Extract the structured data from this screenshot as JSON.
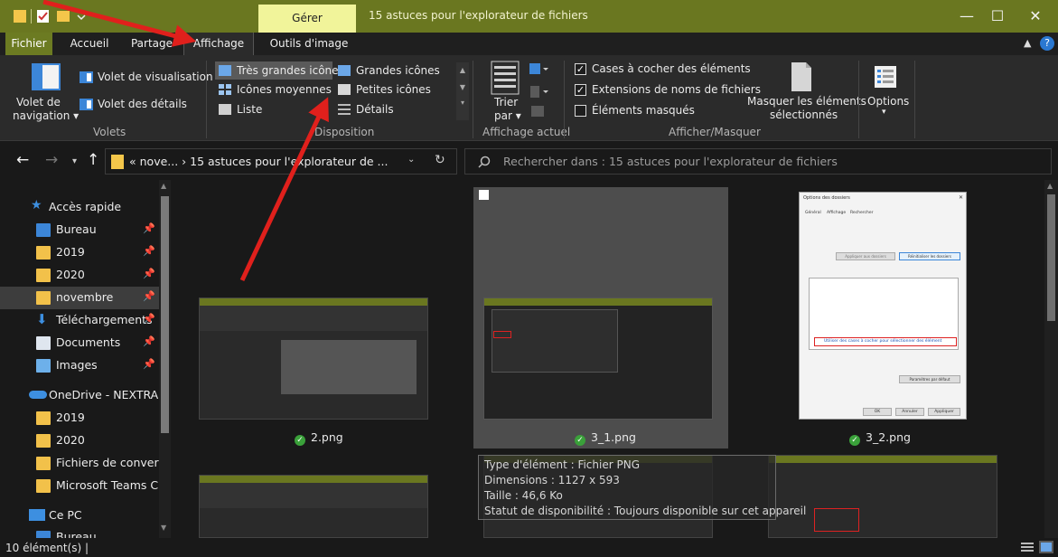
{
  "window": {
    "manage_label": "Gérer",
    "title": "15 astuces pour l'explorateur de fichiers",
    "minimize": "—",
    "maximize": "☐",
    "close": "✕"
  },
  "tabs": [
    "Fichier",
    "Accueil",
    "Partage",
    "Affichage",
    "Outils d'image"
  ],
  "ribbon": {
    "panes": {
      "nav_pane_line1": "Volet de",
      "nav_pane_line2": "navigation ▾",
      "preview_pane": "Volet de visualisation",
      "details_pane": "Volet des détails",
      "group": "Volets"
    },
    "layout": {
      "xl_icons": "Très grandes icônes",
      "large_icons": "Grandes icônes",
      "medium_icons": "Icônes moyennes",
      "small_icons": "Petites icônes",
      "list": "Liste",
      "details": "Détails",
      "group": "Disposition"
    },
    "current_view": {
      "sort_line1": "Trier",
      "sort_line2": "par ▾",
      "group": "Affichage actuel"
    },
    "show_hide": {
      "checkboxes": "Cases à cocher des éléments",
      "extensions": "Extensions de noms de fichiers",
      "hidden": "Éléments masqués",
      "hide_selected_line1": "Masquer les éléments",
      "hide_selected_line2": "sélectionnés",
      "options": "Options",
      "options_caret": "▾",
      "group": "Afficher/Masquer"
    }
  },
  "address": {
    "path": "« nove...  ›  15 astuces pour l'explorateur de ...",
    "search_placeholder": "Rechercher dans : 15 astuces pour l'explorateur de fichiers"
  },
  "sidebar": [
    {
      "label": "Accès rapide",
      "icon": "star-icon"
    },
    {
      "label": "Bureau",
      "icon": "desktop-folder-icon",
      "pinned": true
    },
    {
      "label": "2019",
      "icon": "folder-icon",
      "pinned": true
    },
    {
      "label": "2020",
      "icon": "folder-icon",
      "pinned": true
    },
    {
      "label": "novembre",
      "icon": "folder-icon",
      "pinned": true
    },
    {
      "label": "Téléchargements",
      "icon": "download-icon",
      "pinned": true
    },
    {
      "label": "Documents",
      "icon": "documents-icon",
      "pinned": true
    },
    {
      "label": "Images",
      "icon": "pictures-icon",
      "pinned": true
    },
    {
      "label": "OneDrive - NEXTRADI",
      "icon": "onedrive-icon"
    },
    {
      "label": "2019",
      "icon": "folder-icon"
    },
    {
      "label": "2020",
      "icon": "folder-icon"
    },
    {
      "label": "Fichiers de conversa",
      "icon": "folder-icon"
    },
    {
      "label": "Microsoft Teams Ch",
      "icon": "folder-icon"
    },
    {
      "label": "Ce PC",
      "icon": "computer-icon"
    },
    {
      "label": "Bureau",
      "icon": "desktop-folder-icon"
    }
  ],
  "files": [
    {
      "name": "2.png"
    },
    {
      "name": "3_1.png"
    },
    {
      "name": "3_2.png"
    }
  ],
  "dialog_thumb": {
    "title": "Options des dossiers",
    "tab1": "Général",
    "tab2": "Affichage",
    "tab3": "Rechercher",
    "btn_apply": "Appliquer aux dossiers",
    "btn_reset": "Réinitialiser les dossiers",
    "highlight": "Utiliser des cases à cocher pour sélectionner des élément",
    "btn_default": "Paramètres par défaut",
    "ok": "OK",
    "cancel": "Annuler",
    "apply": "Appliquer"
  },
  "tooltip": {
    "type": "Type d'élément : Fichier PNG",
    "dims": "Dimensions : 1127 x 593",
    "size": "Taille : 46,6 Ko",
    "status": "Statut de disponibilité : Toujours disponible sur cet appareil"
  },
  "status": {
    "count": "10 élément(s)  |"
  },
  "colors": {
    "accent": "#6a7720",
    "manage_tab": "#f1f49a",
    "annotation": "#e0201c"
  }
}
